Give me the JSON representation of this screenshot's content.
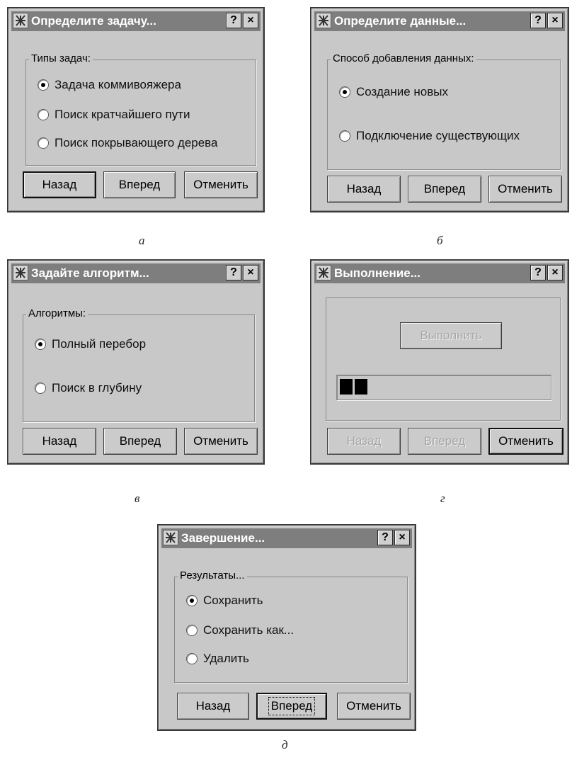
{
  "common": {
    "help_label": "?",
    "close_label": "×",
    "back_label": "Назад",
    "next_label": "Вперед",
    "cancel_label": "Отменить"
  },
  "dialog_a": {
    "title": "Определите задачу...",
    "group_title": "Типы задач:",
    "options": [
      "Задача коммивояжера",
      "Поиск кратчайшего пути",
      "Поиск покрывающего дерева"
    ],
    "selected_index": 0,
    "caption": "а"
  },
  "dialog_b": {
    "title": "Определите данные...",
    "group_title": "Способ добавления данных:",
    "options": [
      "Создание новых",
      "Подключение существующих"
    ],
    "selected_index": 0,
    "caption": "б"
  },
  "dialog_c": {
    "title": "Задайте алгоритм...",
    "group_title": "Алгоритмы:",
    "options": [
      "Полный перебор",
      "Поиск в глубину"
    ],
    "selected_index": 0,
    "caption": "в"
  },
  "dialog_d": {
    "title": "Выполнение...",
    "execute_label": "Выполнить",
    "progress_blocks": 2,
    "caption": "г"
  },
  "dialog_e": {
    "title": "Завершение...",
    "group_title": "Результаты...",
    "options": [
      "Сохранить",
      "Сохранить как...",
      "Удалить"
    ],
    "selected_index": 0,
    "caption": "д"
  },
  "colors": {
    "dialog_bg": "#c8c8c8",
    "titlebar_bg": "#7e7e7e",
    "title_text": "#ffffff"
  }
}
